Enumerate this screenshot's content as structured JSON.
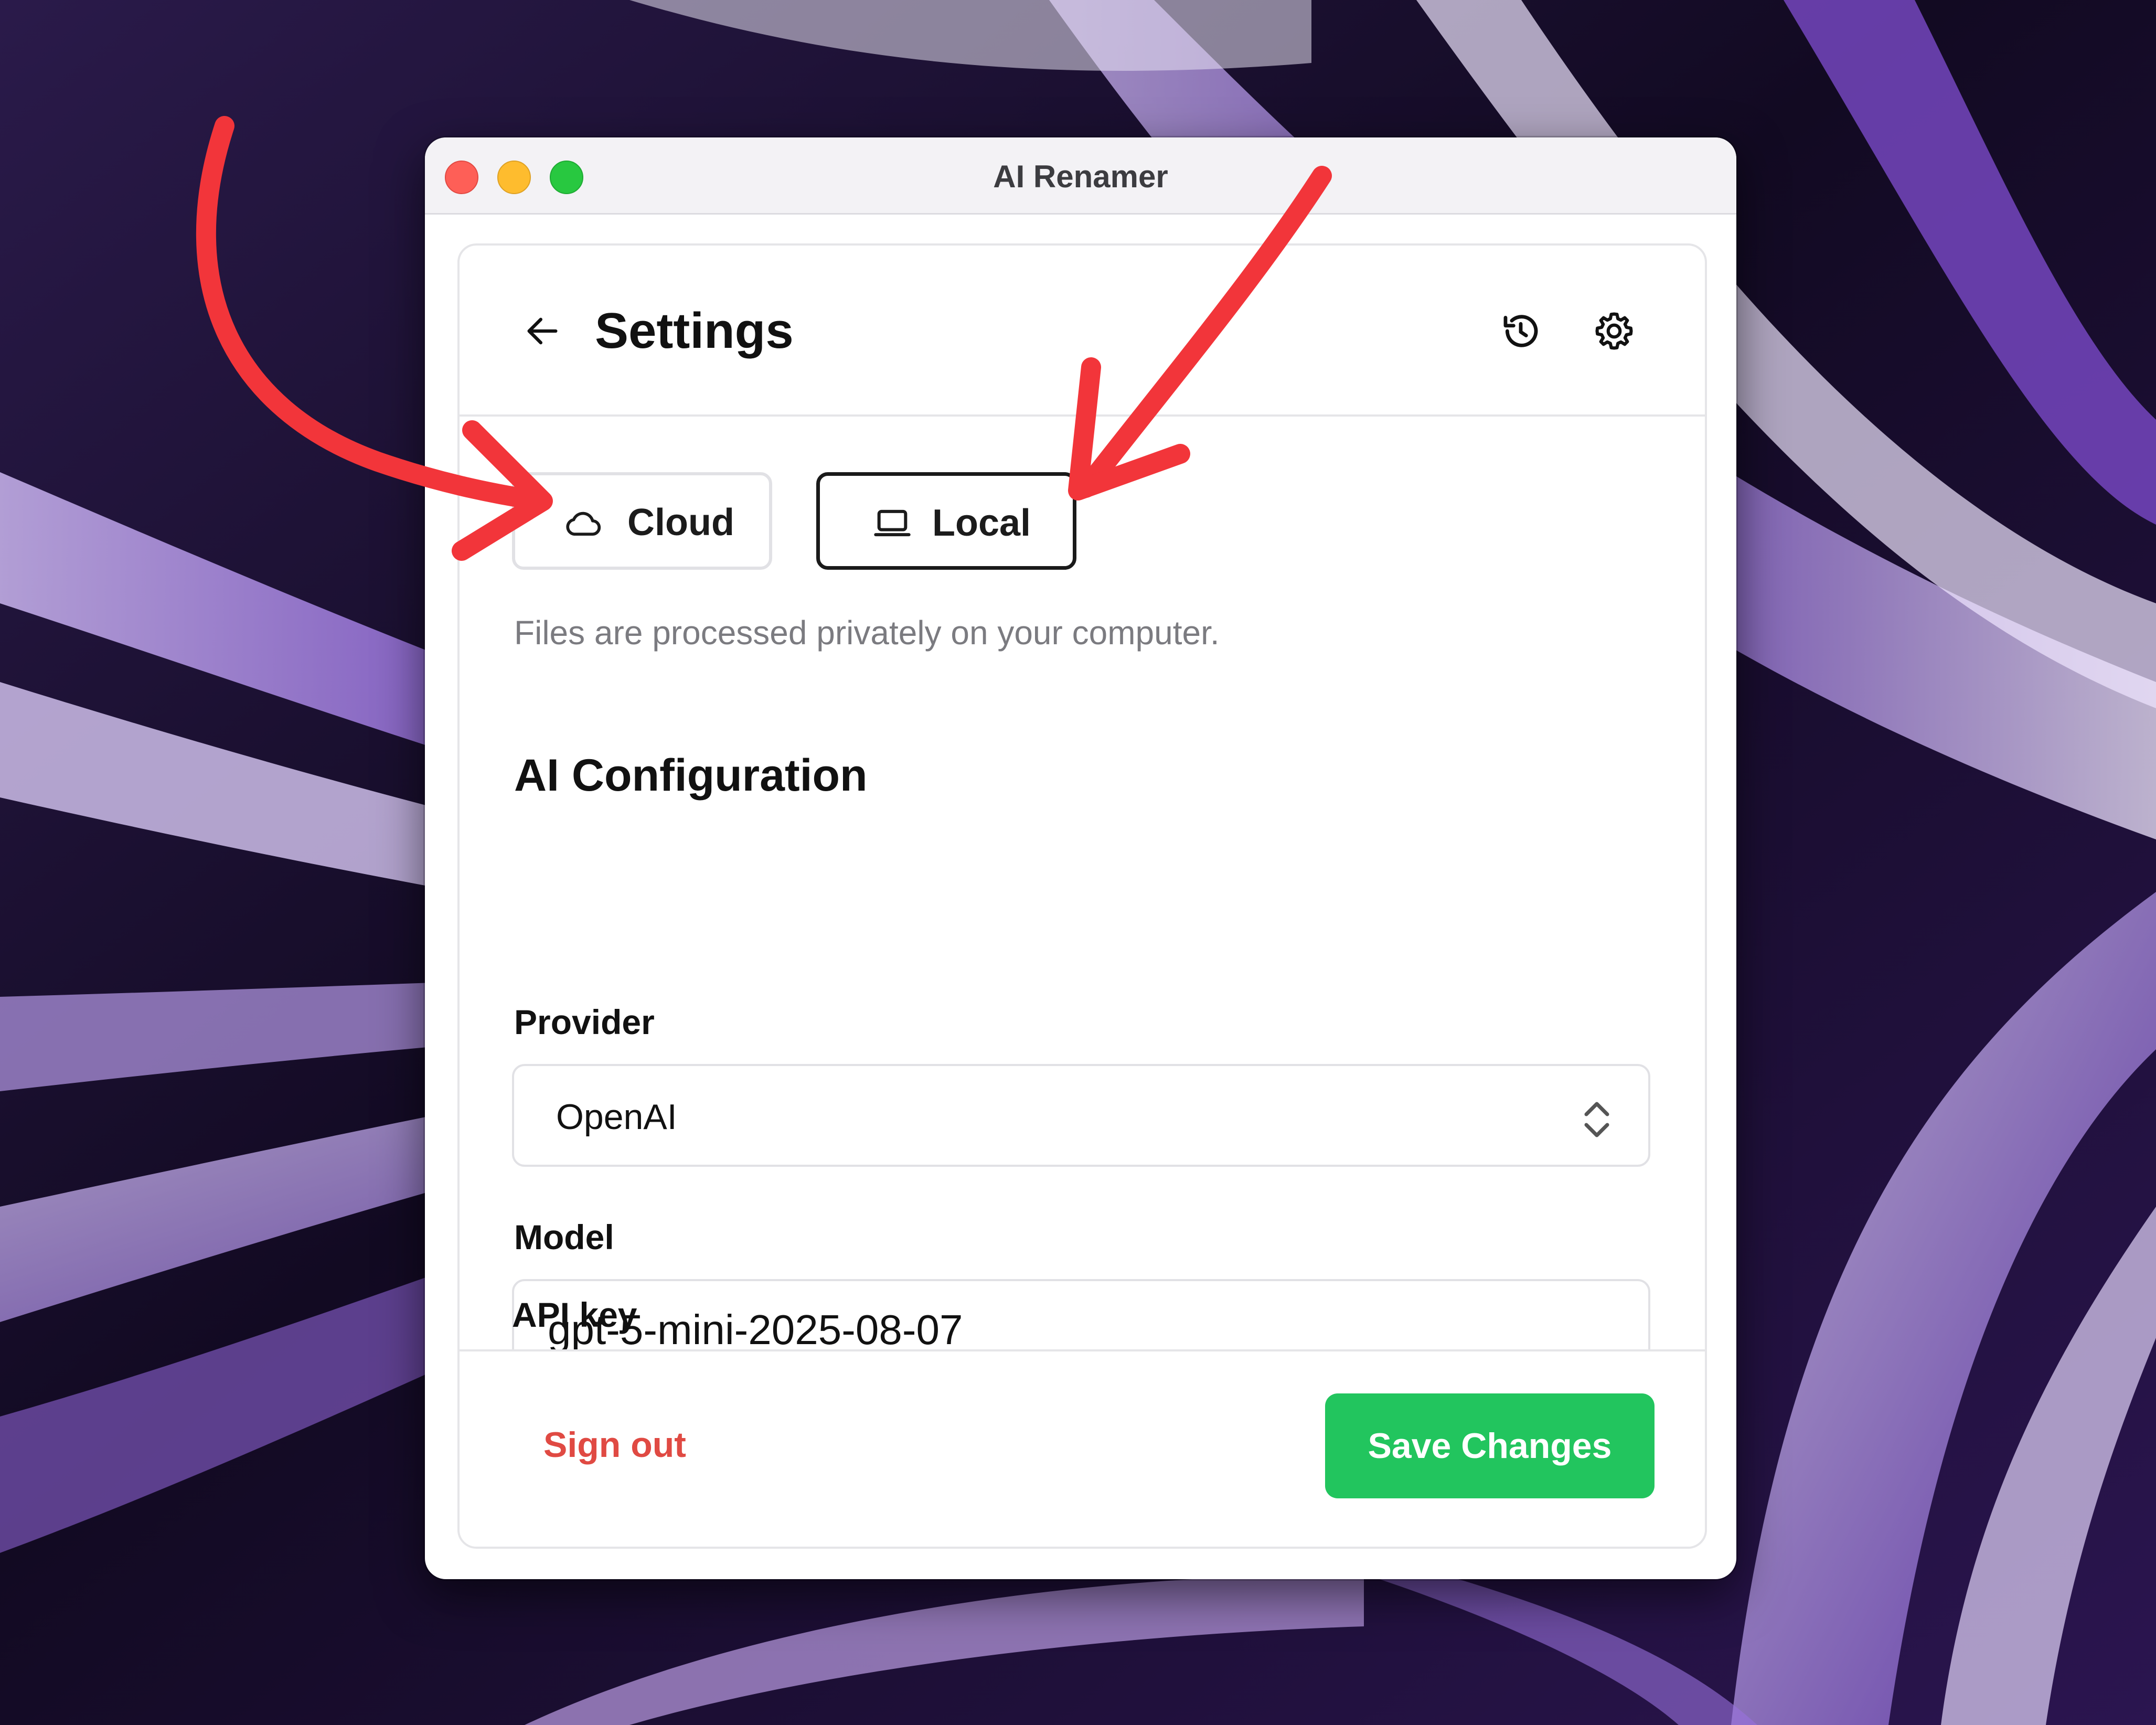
{
  "window": {
    "title": "AI Renamer"
  },
  "header": {
    "title": "Settings",
    "back_icon": "arrow-left-icon",
    "history_icon": "history-icon",
    "settings_icon": "gear-icon"
  },
  "mode": {
    "options": [
      {
        "label": "Cloud",
        "icon": "cloud-icon",
        "selected": false
      },
      {
        "label": "Local",
        "icon": "laptop-icon",
        "selected": true
      }
    ],
    "description": "Files are processed privately on your computer."
  },
  "ai_config": {
    "title": "AI Configuration",
    "provider": {
      "label": "Provider",
      "value": "OpenAI"
    },
    "model": {
      "label": "Model",
      "value": "gpt-5-mini-2025-08-07"
    },
    "api_key": {
      "label": "API key"
    }
  },
  "footer": {
    "signout_label": "Sign out",
    "save_label": "Save Changes"
  },
  "colors": {
    "save_button": "#22c55e",
    "signout_text": "#e04a43",
    "annotation_arrow": "#f2353a"
  }
}
